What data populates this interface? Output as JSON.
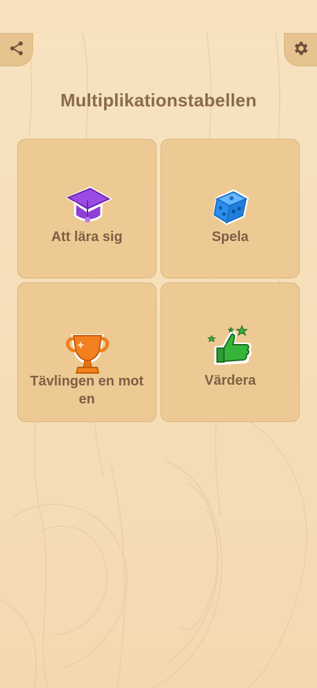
{
  "app": {
    "title": "Multiplikationstabellen"
  },
  "toolbar": {
    "share_icon": "share-icon",
    "settings_icon": "gear-icon"
  },
  "menu": [
    {
      "label": "Att lära sig",
      "icon": "graduation-cap-icon"
    },
    {
      "label": "Spela",
      "icon": "dice-icon"
    },
    {
      "label": "Tävlingen  en mot en",
      "icon": "trophy-icon"
    },
    {
      "label": "Värdera",
      "icon": "thumbs-up-icon"
    }
  ],
  "colors": {
    "background": "#f6e1bd",
    "tile": "#edca93",
    "text": "#8a6a4c",
    "cap": "#8e3fd6",
    "dice": "#2a8ff0",
    "trophy": "#f2801e",
    "thumb": "#35b53a"
  }
}
